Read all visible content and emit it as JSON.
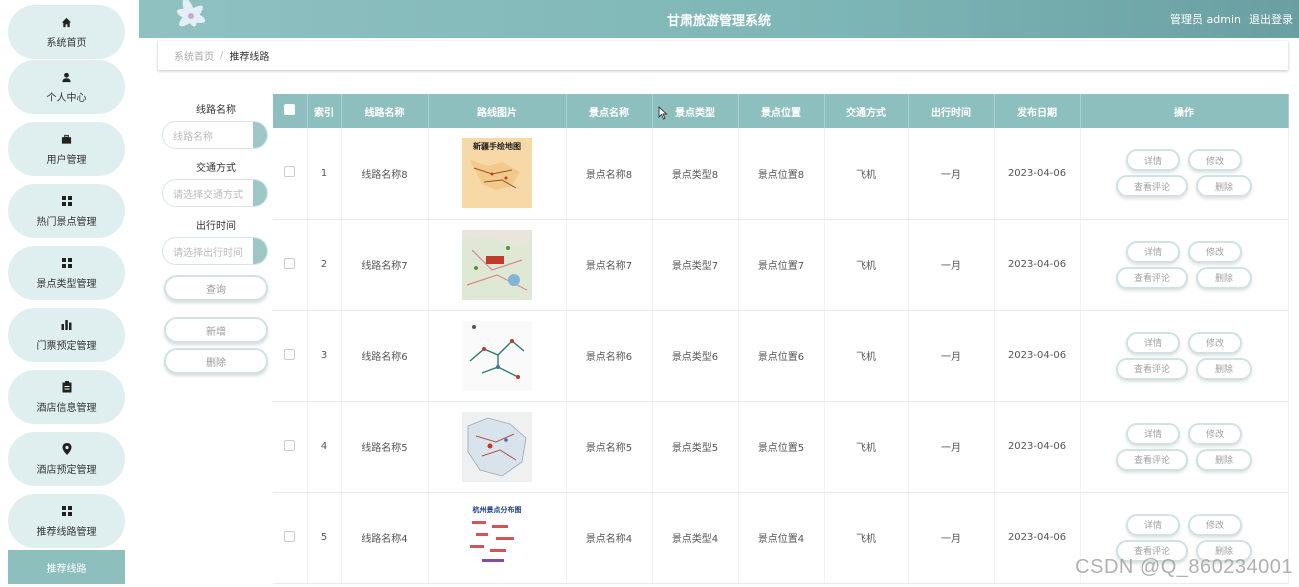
{
  "sidebar": {
    "items": [
      {
        "label": "系统首页",
        "icon": "home-icon"
      },
      {
        "label": "个人中心",
        "icon": "user-icon"
      },
      {
        "label": "用户管理",
        "icon": "briefcase-icon"
      },
      {
        "label": "热门景点管理",
        "icon": "grid-icon"
      },
      {
        "label": "景点类型管理",
        "icon": "grid-icon"
      },
      {
        "label": "门票预定管理",
        "icon": "bar-chart-icon"
      },
      {
        "label": "酒店信息管理",
        "icon": "clipboard-icon"
      },
      {
        "label": "酒店预定管理",
        "icon": "map-pin-icon"
      },
      {
        "label": "推荐线路管理",
        "icon": "grid-icon"
      }
    ],
    "active_label": "推荐线路"
  },
  "header": {
    "title": "甘肃旅游管理系统",
    "user": "管理员 admin",
    "logout": "退出登录"
  },
  "breadcrumb": {
    "home": "系统首页",
    "sep": "/",
    "current": "推荐线路"
  },
  "search": {
    "route_name_label": "线路名称",
    "route_name_placeholder": "线路名称",
    "transport_label": "交通方式",
    "transport_placeholder": "请选择交通方式",
    "departure_label": "出行时间",
    "departure_placeholder": "请选择出行时间",
    "query_button": "查询",
    "add_button": "新增",
    "delete_button": "删除"
  },
  "table": {
    "headers": [
      "索引",
      "线路名称",
      "路线图片",
      "景点名称",
      "景点类型",
      "景点位置",
      "交通方式",
      "出行时间",
      "发布日期",
      "操作"
    ],
    "rows": [
      {
        "index": "1",
        "route": "线路名称8",
        "spot": "景点名称8",
        "type": "景点类型8",
        "location": "景点位置8",
        "transport": "飞机",
        "time": "一月",
        "date": "2023-04-06",
        "img_title": "新疆手绘地图"
      },
      {
        "index": "2",
        "route": "线路名称7",
        "spot": "景点名称7",
        "type": "景点类型7",
        "location": "景点位置7",
        "transport": "飞机",
        "time": "一月",
        "date": "2023-04-06",
        "img_title": ""
      },
      {
        "index": "3",
        "route": "线路名称6",
        "spot": "景点名称6",
        "type": "景点类型6",
        "location": "景点位置6",
        "transport": "飞机",
        "time": "一月",
        "date": "2023-04-06",
        "img_title": ""
      },
      {
        "index": "4",
        "route": "线路名称5",
        "spot": "景点名称5",
        "type": "景点类型5",
        "location": "景点位置5",
        "transport": "飞机",
        "time": "一月",
        "date": "2023-04-06",
        "img_title": ""
      },
      {
        "index": "5",
        "route": "线路名称4",
        "spot": "景点名称4",
        "type": "景点类型4",
        "location": "景点位置4",
        "transport": "飞机",
        "time": "一月",
        "date": "2023-04-06",
        "img_title": "杭州景点分布图"
      }
    ],
    "ops": {
      "detail": "详情",
      "edit": "修改",
      "comments": "查看评论",
      "delete": "删除"
    }
  },
  "watermark": "CSDN @Q_860234001",
  "colors": {
    "accent": "#8ebfbf",
    "sidebar_bg": "#dfeeee",
    "active": "#8dbfbd"
  }
}
